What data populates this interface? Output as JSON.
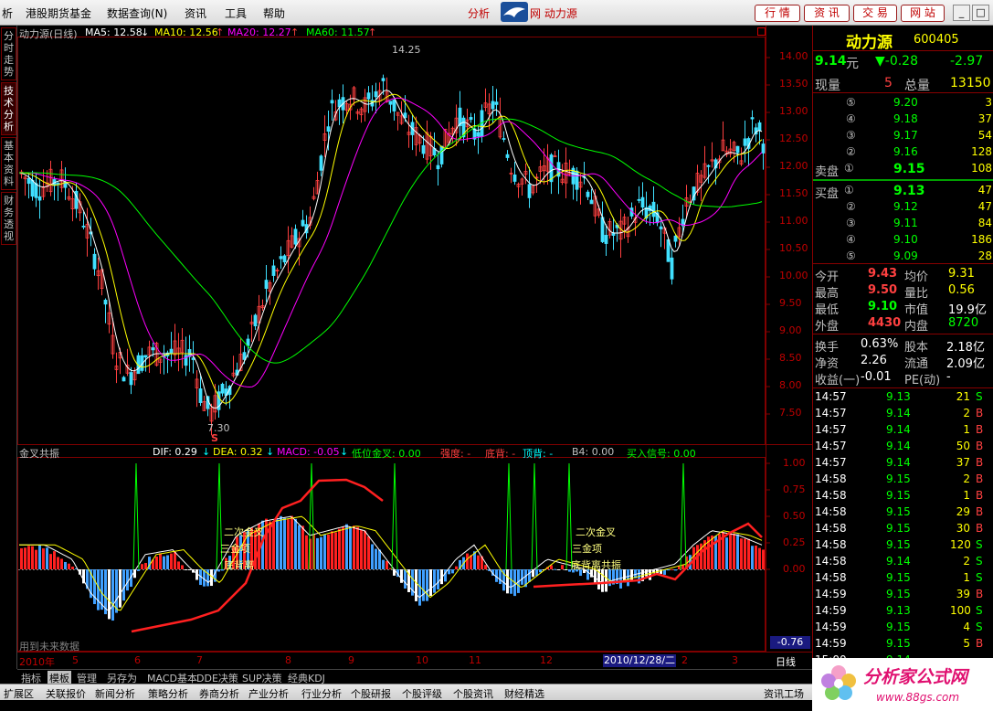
{
  "menubar": {
    "items": [
      "析",
      "港股期货基金",
      "数据查询(N)",
      "资讯",
      "工具",
      "帮助"
    ],
    "center_text": "分析",
    "center_text2": "网 动力源",
    "right_buttons": [
      "行 情",
      "资 讯",
      "交 易",
      "网 站"
    ],
    "window_buttons": [
      "_",
      "□",
      "×"
    ]
  },
  "left_tabs": [
    "分时走势",
    "技术分析",
    "基本资料",
    "财务透视"
  ],
  "main_chart": {
    "title": "动力源(日线)",
    "ma_labels": [
      {
        "text": "MA5: 12.58",
        "color": "#ffffff",
        "arrow": "↓"
      },
      {
        "text": "MA10: 12.56",
        "color": "#ffff00",
        "arrow": "↑"
      },
      {
        "text": "MA20: 12.27",
        "color": "#ff00ff",
        "arrow": "↑"
      },
      {
        "text": "MA60: 11.57",
        "color": "#00ff00",
        "arrow": "↑"
      }
    ],
    "price_ticks": [
      "14.00",
      "13.50",
      "13.00",
      "12.50",
      "12.00",
      "11.50",
      "11.00",
      "10.50",
      "10.00",
      "9.50",
      "9.00",
      "8.50",
      "8.00",
      "7.50"
    ],
    "high_label": "14.25",
    "low_label": "7.30",
    "low_mark": "S"
  },
  "indicator": {
    "title": "金叉共振",
    "labels": [
      {
        "text": "DIF: 0.29",
        "color": "#ffffff",
        "arrow": "↓"
      },
      {
        "text": "DEA: 0.32",
        "color": "#ffff00",
        "arrow": "↓"
      },
      {
        "text": "MACD: -0.05",
        "color": "#ff00ff",
        "arrow": "↓"
      },
      {
        "text": "低位金叉: 0.00",
        "color": "#00ff00",
        "arrow": ""
      },
      {
        "text": "强度: -",
        "color": "#ff4040",
        "arrow": ""
      },
      {
        "text": "底背: -",
        "color": "#ff4040",
        "arrow": ""
      },
      {
        "text": "顶背: -",
        "color": "#00ffff",
        "arrow": ""
      },
      {
        "text": "B4: 0.00",
        "color": "#c0c0c0",
        "arrow": ""
      },
      {
        "text": "买入信号: 0.00",
        "color": "#00ff00",
        "arrow": ""
      }
    ],
    "ticks": [
      "1.00",
      "0.75",
      "0.50",
      "0.25",
      "0.00"
    ],
    "current_value": "-0.76",
    "annotations_left": [
      "二次金叉",
      "三金项",
      "底背离"
    ],
    "annotations_right": [
      "二次金叉",
      "三金项",
      "底背离共振"
    ],
    "footnote": "用到未来数据"
  },
  "time_axis": {
    "labels": [
      "2010年",
      "5",
      "6",
      "7",
      "8",
      "9",
      "10",
      "11",
      "12",
      "2",
      "3"
    ],
    "cursor_date": "2010/12/28/二",
    "period": "日线"
  },
  "quote": {
    "name": "动力源",
    "code": "600405",
    "price": "9.14",
    "price_unit": "元",
    "change": "▼-0.28",
    "change_pct": "-2.97",
    "volume_now_label": "现量",
    "volume_now": "5",
    "volume_total_label": "总量",
    "volume_total": "13150",
    "sell_label": "卖盘",
    "buy_label": "买盘",
    "sells": [
      {
        "lvl": "⑤",
        "price": "9.20",
        "vol": "3"
      },
      {
        "lvl": "④",
        "price": "9.18",
        "vol": "37"
      },
      {
        "lvl": "③",
        "price": "9.17",
        "vol": "54"
      },
      {
        "lvl": "②",
        "price": "9.16",
        "vol": "128"
      },
      {
        "lvl": "①",
        "price": "9.15",
        "vol": "108"
      }
    ],
    "buys": [
      {
        "lvl": "①",
        "price": "9.13",
        "vol": "47"
      },
      {
        "lvl": "②",
        "price": "9.12",
        "vol": "47"
      },
      {
        "lvl": "③",
        "price": "9.11",
        "vol": "84"
      },
      {
        "lvl": "④",
        "price": "9.10",
        "vol": "186"
      },
      {
        "lvl": "⑤",
        "price": "9.09",
        "vol": "28"
      }
    ],
    "stats": [
      {
        "l1": "今开",
        "v1": "9.43",
        "c1": "#ff4040",
        "l2": "均价",
        "v2": "9.31",
        "c2": "#ffff00"
      },
      {
        "l1": "最高",
        "v1": "9.50",
        "c1": "#ff4040",
        "l2": "量比",
        "v2": "0.56",
        "c2": "#ffff00"
      },
      {
        "l1": "最低",
        "v1": "9.10",
        "c1": "#00ff00",
        "l2": "市值",
        "v2": "19.9亿",
        "c2": "#ffffff"
      },
      {
        "l1": "外盘",
        "v1": "4430",
        "c1": "#ff4040",
        "l2": "内盘",
        "v2": "8720",
        "c2": "#00ff00"
      }
    ],
    "fin": [
      {
        "l1": "换手",
        "v1": "0.63%",
        "l2": "股本",
        "v2": "2.18亿"
      },
      {
        "l1": "净资",
        "v1": "2.26",
        "l2": "流通",
        "v2": "2.09亿"
      },
      {
        "l1": "收益(一)",
        "v1": "-0.01",
        "l2": "PE(动)",
        "v2": "-"
      }
    ],
    "ticks": [
      {
        "time": "14:57",
        "price": "9.13",
        "vol": "21",
        "bs": "S"
      },
      {
        "time": "14:57",
        "price": "9.14",
        "vol": "2",
        "bs": "B"
      },
      {
        "time": "14:57",
        "price": "9.14",
        "vol": "1",
        "bs": "B"
      },
      {
        "time": "14:57",
        "price": "9.14",
        "vol": "50",
        "bs": "B"
      },
      {
        "time": "14:57",
        "price": "9.14",
        "vol": "37",
        "bs": "B"
      },
      {
        "time": "14:58",
        "price": "9.15",
        "vol": "2",
        "bs": "B"
      },
      {
        "time": "14:58",
        "price": "9.15",
        "vol": "1",
        "bs": "B"
      },
      {
        "time": "14:58",
        "price": "9.15",
        "vol": "29",
        "bs": "B"
      },
      {
        "time": "14:58",
        "price": "9.15",
        "vol": "30",
        "bs": "B"
      },
      {
        "time": "14:58",
        "price": "9.15",
        "vol": "120",
        "bs": "S"
      },
      {
        "time": "14:58",
        "price": "9.14",
        "vol": "2",
        "bs": "S"
      },
      {
        "time": "14:58",
        "price": "9.15",
        "vol": "1",
        "bs": "S"
      },
      {
        "time": "14:59",
        "price": "9.15",
        "vol": "39",
        "bs": "B"
      },
      {
        "time": "14:59",
        "price": "9.13",
        "vol": "100",
        "bs": "S"
      },
      {
        "time": "14:59",
        "price": "9.15",
        "vol": "4",
        "bs": "S"
      },
      {
        "time": "14:59",
        "price": "9.15",
        "vol": "5",
        "bs": "B"
      },
      {
        "time": "15:00",
        "price": "9.14",
        "vol": "",
        "bs": ""
      }
    ]
  },
  "bottom_tabs1": [
    "指标",
    "模板",
    "管理",
    "另存为",
    "MACD基本",
    "DDE决策",
    "SUP决策",
    "经典KDJ"
  ],
  "bottom_tabs2": [
    "扩展区",
    "关联报价",
    "新闻分析",
    "策略分析",
    "券商分析",
    "产业分析",
    "行业分析",
    "个股研报",
    "个股评级",
    "个股资讯",
    "财经精选"
  ],
  "bottom_tabs2_right": "资讯工场",
  "brand": {
    "name": "分析家公式网",
    "url": "www.88gs.com"
  }
}
